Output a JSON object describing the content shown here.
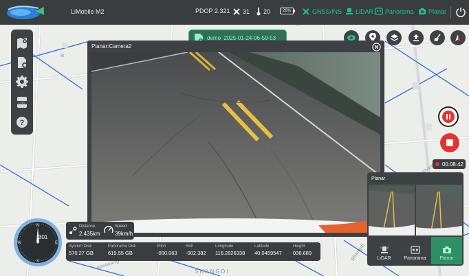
{
  "topbar": {
    "app_title": "LiMobile M2",
    "pdop": "PDOP 2.321",
    "satellites": "31",
    "temperature": "20",
    "battery": "26%",
    "gnss_label": "GNSS/INS",
    "lidar_label": "LiDAR",
    "panorama_label": "Panorama",
    "planar_label": "Planar"
  },
  "file_badge": {
    "name": "demo_2025-01-24-06-59-53"
  },
  "camera_panel": {
    "title": "Planar:Camera2"
  },
  "recording": {
    "timer": "00:08:42"
  },
  "planar_panel": {
    "title": "Planar",
    "tabs": [
      {
        "label": "LiDAR"
      },
      {
        "label": "Panorama"
      },
      {
        "label": "Planar"
      }
    ]
  },
  "compass": {
    "heading": "301"
  },
  "motion": {
    "distance_label": "Distance",
    "distance_value": "2.435km",
    "speed_label": "Speed",
    "speed_value": "39km/h"
  },
  "stats": [
    {
      "label": "System Disk",
      "value": "570.27 GB"
    },
    {
      "label": "Panorama Disk",
      "value": "619.55 GB"
    },
    {
      "label": "Pitch",
      "value": "-000.063"
    },
    {
      "label": "Roll",
      "value": "-002.382"
    },
    {
      "label": "Longitude",
      "value": "116.2826338"
    },
    {
      "label": "Latitude",
      "value": "40.0459547"
    },
    {
      "label": "Height",
      "value": "036.689"
    }
  ],
  "map": {
    "road_label_1": "SHANGDI",
    "road_label_2": "gbeiwang",
    "road_label_3": "Shang",
    "road_label_4": "Shangdi"
  },
  "colors": {
    "accent_green": "#1fc389",
    "record_red": "#e8322f",
    "panel_dark": "#3a3d40",
    "route_blue": "#2a6fe0"
  }
}
